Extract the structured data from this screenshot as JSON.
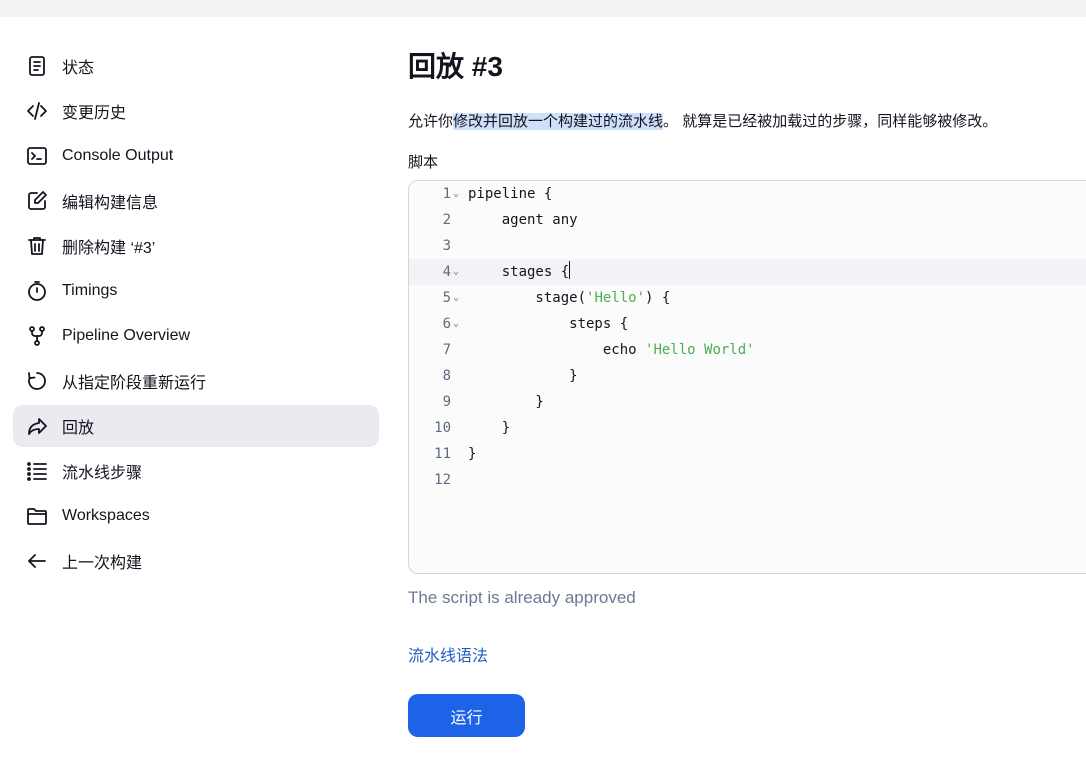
{
  "sidebar": {
    "items": [
      {
        "label": "状态",
        "icon": "document-icon",
        "active": false
      },
      {
        "label": "变更历史",
        "icon": "code-icon",
        "active": false
      },
      {
        "label": "Console Output",
        "icon": "terminal-icon",
        "active": false
      },
      {
        "label": "编辑构建信息",
        "icon": "edit-icon",
        "active": false
      },
      {
        "label": "删除构建 ‘#3’",
        "icon": "trash-icon",
        "active": false
      },
      {
        "label": "Timings",
        "icon": "stopwatch-icon",
        "active": false
      },
      {
        "label": "Pipeline Overview",
        "icon": "branch-icon",
        "active": false
      },
      {
        "label": "从指定阶段重新运行",
        "icon": "restart-icon",
        "active": false
      },
      {
        "label": "回放",
        "icon": "replay-icon",
        "active": true
      },
      {
        "label": "流水线步骤",
        "icon": "list-icon",
        "active": false
      },
      {
        "label": "Workspaces",
        "icon": "folder-icon",
        "active": false
      },
      {
        "label": "上一次构建",
        "icon": "arrow-left-icon",
        "active": false
      }
    ]
  },
  "main": {
    "title": "回放 #3",
    "description": {
      "prefix": "允许你",
      "highlight": "修改并回放一个构建过的流水线",
      "suffix": "。 就算是已经被加载过的步骤，同样能够被修改。"
    },
    "script_label": "脚本",
    "editor": {
      "lines": [
        {
          "num": "1",
          "fold": true,
          "parts": [
            {
              "t": "pipeline {",
              "s": false
            }
          ]
        },
        {
          "num": "2",
          "fold": false,
          "parts": [
            {
              "t": "    agent any",
              "s": false
            }
          ]
        },
        {
          "num": "3",
          "fold": false,
          "parts": []
        },
        {
          "num": "4",
          "fold": true,
          "parts": [
            {
              "t": "    stages {",
              "s": false
            }
          ]
        },
        {
          "num": "5",
          "fold": true,
          "parts": [
            {
              "t": "        stage(",
              "s": false
            },
            {
              "t": "'Hello'",
              "s": true
            },
            {
              "t": ") {",
              "s": false
            }
          ]
        },
        {
          "num": "6",
          "fold": true,
          "parts": [
            {
              "t": "            steps {",
              "s": false
            }
          ]
        },
        {
          "num": "7",
          "fold": false,
          "parts": [
            {
              "t": "                echo ",
              "s": false
            },
            {
              "t": "'Hello World'",
              "s": true
            }
          ]
        },
        {
          "num": "8",
          "fold": false,
          "parts": [
            {
              "t": "            }",
              "s": false
            }
          ]
        },
        {
          "num": "9",
          "fold": false,
          "parts": [
            {
              "t": "        }",
              "s": false
            }
          ]
        },
        {
          "num": "10",
          "fold": false,
          "parts": [
            {
              "t": "    }",
              "s": false
            }
          ]
        },
        {
          "num": "11",
          "fold": false,
          "parts": [
            {
              "t": "}",
              "s": false
            }
          ]
        },
        {
          "num": "12",
          "fold": false,
          "parts": []
        }
      ],
      "active_line": 4
    },
    "approved_text": "The script is already approved",
    "syntax_link": "流水线语法",
    "run_button": "运行"
  },
  "colors": {
    "accent": "#1d63e8",
    "link": "#1f5fbf",
    "string": "#4caf50",
    "active_bg": "#e9ebf1",
    "highlight": "#cfe0fb"
  }
}
